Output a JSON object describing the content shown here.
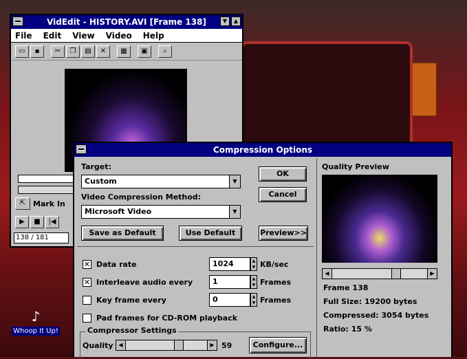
{
  "colors": {
    "title_bar": "#000080",
    "window": "#c0c0c0",
    "desktop": "#8a1518"
  },
  "videdit": {
    "title": "VidEdit - HISTORY.AVI [Frame 138]",
    "menu": [
      "File",
      "Edit",
      "View",
      "Video",
      "Help"
    ],
    "toolbar_icons": [
      "open-icon",
      "save-icon",
      "cut-icon",
      "copy-icon",
      "paste-icon",
      "delete-icon",
      "insert-icon",
      "crop-icon",
      "zoom-icon"
    ],
    "mark_label": "Mark In",
    "frame_counter": "138 / 181"
  },
  "desktop_icon": {
    "label": "Whoop It Up!",
    "icon": "speaker-icon"
  },
  "dialog": {
    "title": "Compression Options",
    "target_label": "Target:",
    "target_value": "Custom",
    "method_label": "Video Compression Method:",
    "method_value": "Microsoft Video",
    "ok": "OK",
    "cancel": "Cancel",
    "save_default": "Save as Default",
    "use_default": "Use Default",
    "preview": "Preview>>",
    "data_rate_label": "Data rate",
    "data_rate_value": "1024",
    "data_rate_unit": "KB/sec",
    "data_rate_checked": true,
    "interleave_label": "Interleave audio every",
    "interleave_value": "1",
    "interleave_unit": "Frames",
    "interleave_checked": true,
    "keyframe_label": "Key frame every",
    "keyframe_value": "0",
    "keyframe_unit": "Frames",
    "keyframe_checked": false,
    "pad_label": "Pad frames for CD-ROM playback",
    "pad_checked": false,
    "compressor_group": "Compressor Settings",
    "quality_label": "Quality",
    "quality_value": "59",
    "configure": "Configure...",
    "preview_panel": {
      "title": "Quality Preview",
      "frame": "Frame 138",
      "full_size": "Full Size: 19200 bytes",
      "compressed": "Compressed: 3054 bytes",
      "ratio": "Ratio: 15 %"
    }
  }
}
